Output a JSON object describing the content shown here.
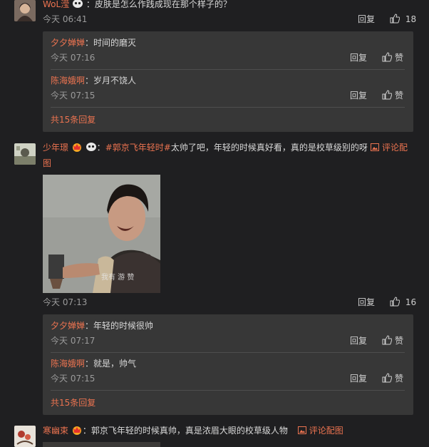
{
  "comment1": {
    "user": "WoL滢",
    "text": "：皮肤是怎么作践成现在那个样子的？",
    "time": "今天 06:41",
    "reply": "回复",
    "likes": "18",
    "subs": [
      {
        "user": "夕夕婵婵",
        "text": "：时间的磨灭",
        "time": "今天 07:16",
        "reply": "回复",
        "like": "赞"
      },
      {
        "user": "陈海娥啊",
        "text": "：岁月不饶人",
        "time": "今天 07:15",
        "reply": "回复",
        "like": "赞"
      }
    ],
    "more": "共15条回复"
  },
  "comment2": {
    "user": "少年璟",
    "topic": "#郭京飞年轻时#",
    "text": "太帅了吧，年轻的时候真好看，真的是校草级别的呀",
    "pic_link_a": "评论配",
    "pic_link_b": "图",
    "image_watermark": "我有 游 赞",
    "time": "今天 07:13",
    "reply": "回复",
    "likes": "16",
    "subs": [
      {
        "user": "夕夕婵婵",
        "text": "：年轻的时候很帅",
        "time": "今天 07:17",
        "reply": "回复",
        "like": "赞"
      },
      {
        "user": "陈海娥啊",
        "text": "：就是，帅气",
        "time": "今天 07:15",
        "reply": "回复",
        "like": "赞"
      }
    ],
    "more": "共15条回复"
  },
  "comment3": {
    "user": "寒幽束",
    "text": "：郭京飞年轻的时候真帅，真是浓眉大眼的校草级人物",
    "pic_link": "评论配图"
  },
  "colors": {
    "accent": "#eb7350",
    "background": "#1f1f21",
    "reply_box": "#373737"
  }
}
